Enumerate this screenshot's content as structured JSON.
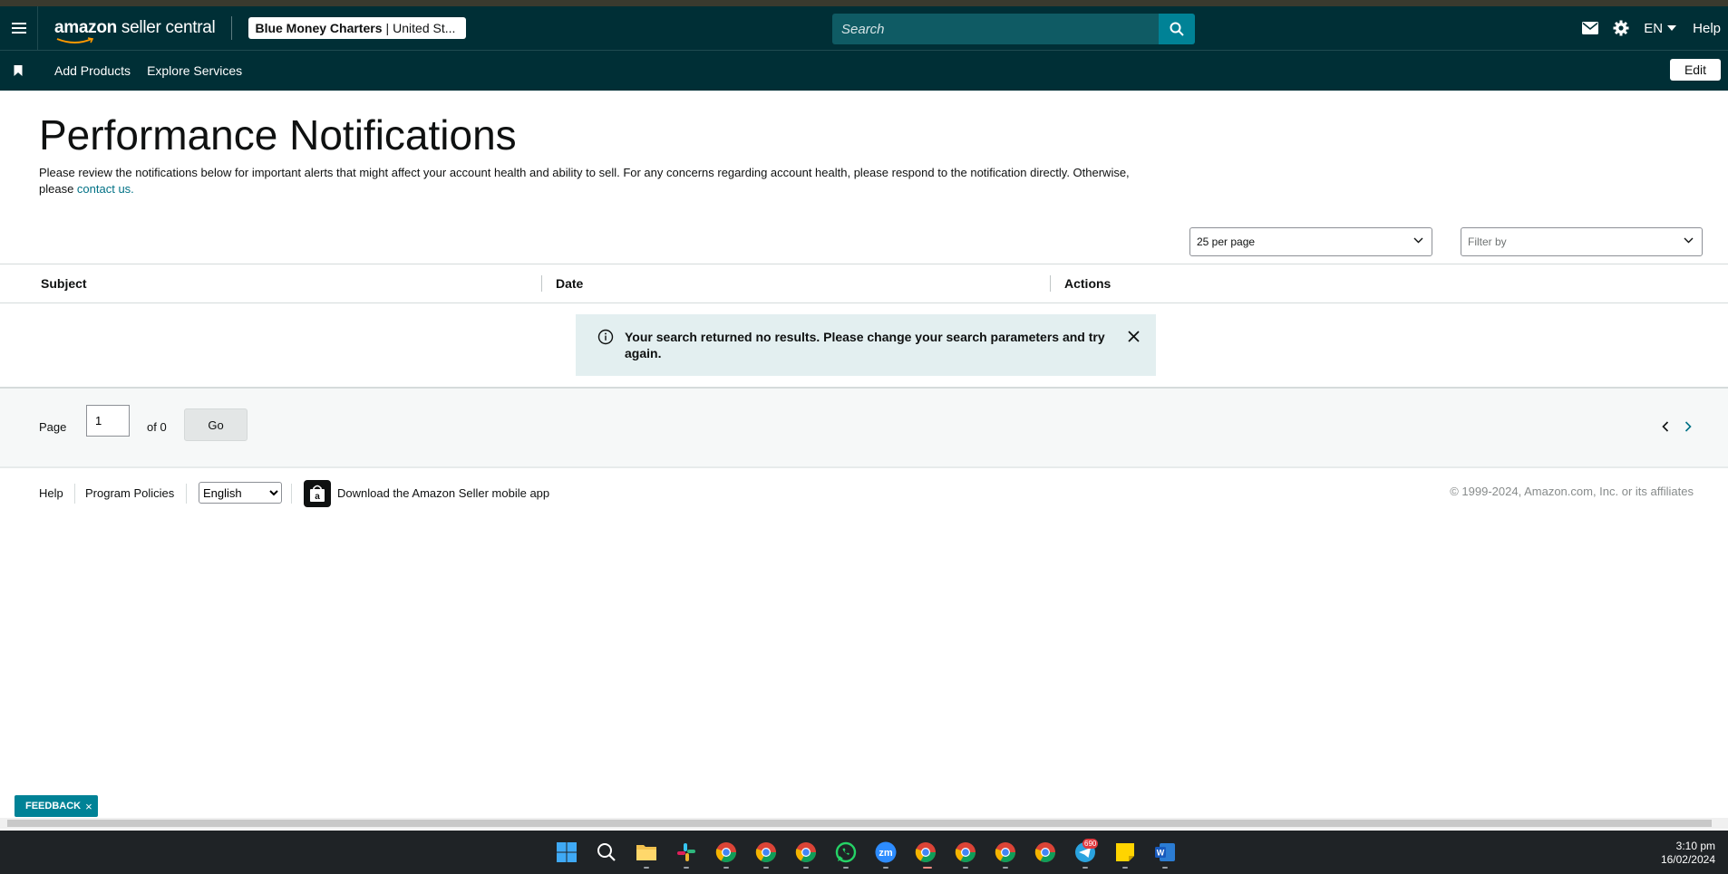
{
  "header": {
    "logo_text_bold": "amazon",
    "logo_text": " seller central",
    "account_name": "Blue Money Charters",
    "account_region": "United St...",
    "search_placeholder": "Search",
    "language": "EN",
    "help": "Help"
  },
  "nav": {
    "items": [
      {
        "label": "Add Products"
      },
      {
        "label": "Explore Services"
      }
    ],
    "edit_label": "Edit"
  },
  "page": {
    "title": "Performance Notifications",
    "description": "Please review the notifications below for important alerts that might affect your account health and ability to sell. For any concerns regarding account health, please respond to the notification directly. Otherwise, please ",
    "contact_link": "contact us."
  },
  "controls": {
    "per_page": "25 per page",
    "filter_placeholder": "Filter by"
  },
  "table": {
    "columns": [
      "Subject",
      "Date",
      "Actions"
    ]
  },
  "alert": {
    "message": "Your search returned no results. Please change your search parameters and try again."
  },
  "pagination": {
    "page_label": "Page",
    "current_page": "1",
    "of_label": "of 0",
    "go_label": "Go"
  },
  "footer": {
    "help": "Help",
    "program_policies": "Program Policies",
    "language_option": "English",
    "app_link": "Download the Amazon Seller mobile app",
    "copyright": "© 1999-2024, Amazon.com, Inc. or its affiliates"
  },
  "feedback": {
    "label": "FEEDBACK",
    "close": "×"
  },
  "taskbar": {
    "time": "3:10 pm",
    "date": "16/02/2024",
    "telegram_badge": "690",
    "icons": [
      "windows-start-icon",
      "search-icon",
      "file-explorer-icon",
      "slack-icon",
      "chrome-icon",
      "chrome-icon",
      "chrome-icon",
      "whatsapp-icon",
      "zoom-icon",
      "chrome-icon",
      "chrome-icon",
      "chrome-icon",
      "chrome-icon",
      "telegram-icon",
      "sticky-notes-icon",
      "word-icon"
    ]
  },
  "colors": {
    "header_bg": "#002f36",
    "accent": "#008296",
    "link": "#007185",
    "alert_bg": "#e3eff0"
  }
}
